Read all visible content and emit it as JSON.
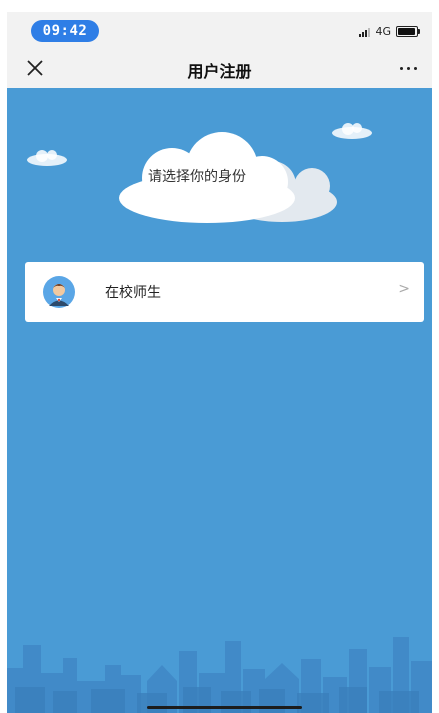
{
  "status_bar": {
    "time": "09:42",
    "network": "4G"
  },
  "nav": {
    "title": "用户注册",
    "close_icon": "close-icon",
    "more_icon": "more-dots-icon"
  },
  "prompt": {
    "text": "请选择你的身份"
  },
  "identity_options": [
    {
      "label": "在校师生",
      "icon": "teacher-avatar-icon",
      "chevron": ">"
    }
  ],
  "colors": {
    "time_pill": "#2f7ee6",
    "background": "#4a9bd5",
    "cloud": "#ffffff",
    "skyline": "#3f87c6"
  }
}
